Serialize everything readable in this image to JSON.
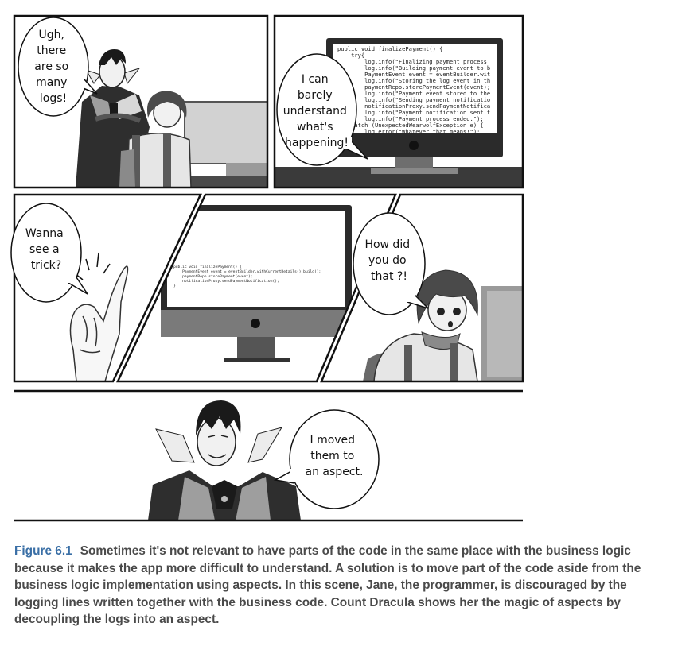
{
  "panels": [
    {
      "id": "panel-1",
      "bubble": [
        "Ugh,",
        "there",
        "are so",
        "many",
        "logs!"
      ]
    },
    {
      "id": "panel-2",
      "bubble": [
        "I can",
        "barely",
        "understand",
        "what's",
        "happening!"
      ],
      "code": [
        "public void finalizePayment() {",
        "    try{",
        "        log.info(\"Finalizing payment process",
        "        log.info(\"Building payment event to b",
        "        PaymentEvent event = eventBuilder.wit",
        "        log.info(\"Storing the log event in th",
        "        paymentRepo.storePaymentEvent(event);",
        "        log.info(\"Payment event stored to the",
        "        log.info(\"Sending payment notificatio",
        "        notificationProxy.sendPaymentNotifica",
        "        log.info(\"Payment notification sent t",
        "        log.info(\"Payment process ended.\");",
        "    catch (UnexpectedWearwolfException e) {",
        "        log.error(\"Whatever that means!\");"
      ]
    },
    {
      "id": "panel-3",
      "bubble": [
        "Wanna",
        "see a",
        "trick?"
      ]
    },
    {
      "id": "panel-4",
      "code": [
        "public void finalizePayment() {",
        "    PaymentEvent event = eventBuilder.withCurrentDetails().build();",
        "    paymentRepo.storePayment(event);",
        "    notificationProxy.sendPaymentNotification();",
        "}"
      ]
    },
    {
      "id": "panel-5",
      "bubble": [
        "How did",
        "you do",
        "that ?!"
      ]
    },
    {
      "id": "panel-6",
      "bubble": [
        "I moved",
        "them to",
        "an aspect."
      ]
    }
  ],
  "caption": {
    "figure_number": "Figure 6.1",
    "text": "Sometimes it's not relevant to have parts of the code in the same place with the business logic because it makes the app more difficult to understand. A solution is to move part of the code aside from the business logic implementation using aspects. In this scene, Jane, the programmer, is discouraged by the logging lines written together with the business code. Count Dracula shows her the magic of aspects by decoupling the logs into an aspect."
  },
  "colors": {
    "panel_border": "#111111",
    "monitor_dark": "#2b2b2b",
    "figure_label": "#3a6fa6",
    "caption_text": "#4a4a4a"
  }
}
